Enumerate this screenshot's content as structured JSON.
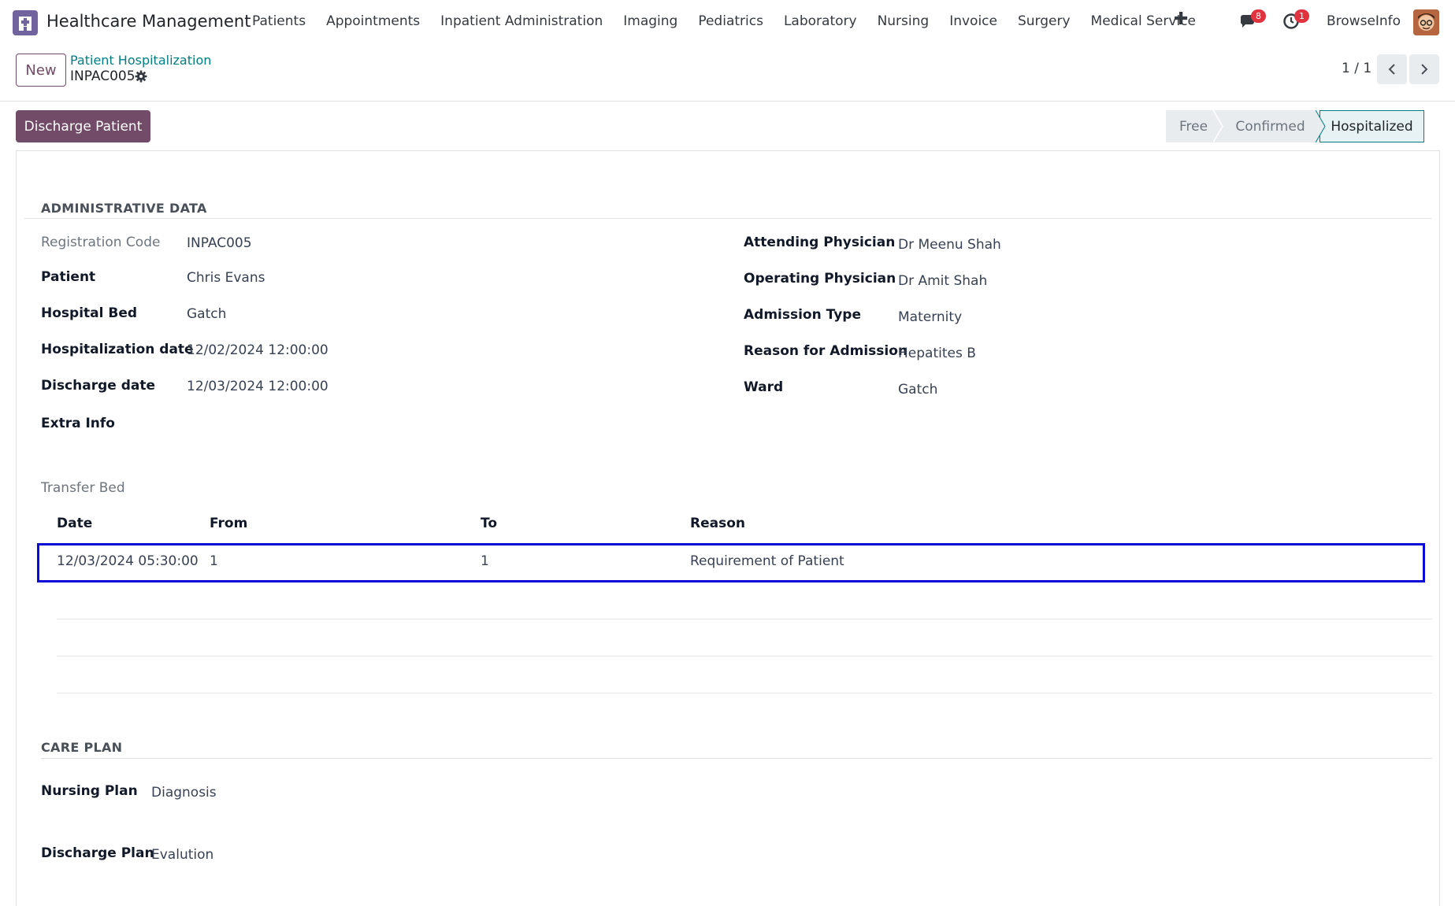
{
  "navbar": {
    "app_name": "Healthcare Management",
    "menu": [
      "Patients",
      "Appointments",
      "Inpatient Administration",
      "Imaging",
      "Pediatrics",
      "Laboratory",
      "Nursing",
      "Invoice",
      "Surgery",
      "Medical Service"
    ],
    "plus": "✚",
    "messages_badge": "8",
    "activity_badge": "1",
    "user": "BrowseInfo"
  },
  "control": {
    "new_label": "New",
    "breadcrumb": "Patient Hospitalization",
    "record": "INPAC005",
    "pager": "1 / 1"
  },
  "actions": {
    "discharge_label": "Discharge Patient"
  },
  "statusbar": {
    "stages": [
      "Free",
      "Confirmed",
      "Hospitalized"
    ],
    "active": "Hospitalized"
  },
  "admin": {
    "title": "ADMINISTRATIVE DATA",
    "left": [
      {
        "label": "Registration Code",
        "value": "INPAC005"
      },
      {
        "label": "Patient",
        "value": "Chris Evans"
      },
      {
        "label": "Hospital Bed",
        "value": "Gatch"
      },
      {
        "label": "Hospitalization date",
        "value": "12/02/2024 12:00:00"
      },
      {
        "label": "Discharge date",
        "value": "12/03/2024 12:00:00"
      },
      {
        "label": "Extra Info",
        "value": ""
      }
    ],
    "right": [
      {
        "label": "Attending Physician",
        "value": "Dr Meenu Shah"
      },
      {
        "label": "Operating Physician",
        "value": "Dr Amit Shah"
      },
      {
        "label": "Admission Type",
        "value": "Maternity"
      },
      {
        "label": "Reason for Admission",
        "value": "Hepatites B"
      },
      {
        "label": "Ward",
        "value": "Gatch"
      }
    ]
  },
  "transfer": {
    "title": "Transfer Bed",
    "columns": [
      "Date",
      "From",
      "To",
      "Reason"
    ],
    "rows": [
      {
        "date": "12/03/2024 05:30:00",
        "from": "1",
        "to": "1",
        "reason": "Requirement of Patient"
      }
    ]
  },
  "care": {
    "title": "CARE PLAN",
    "nursing_label": "Nursing Plan",
    "nursing_value": "Diagnosis",
    "discharge_label": "Discharge Plan",
    "discharge_value": "Evalution"
  },
  "colors": {
    "brand": "#714b67",
    "link": "#017e84",
    "highlight": "#0a0ad6",
    "badge": "#e0323f"
  }
}
